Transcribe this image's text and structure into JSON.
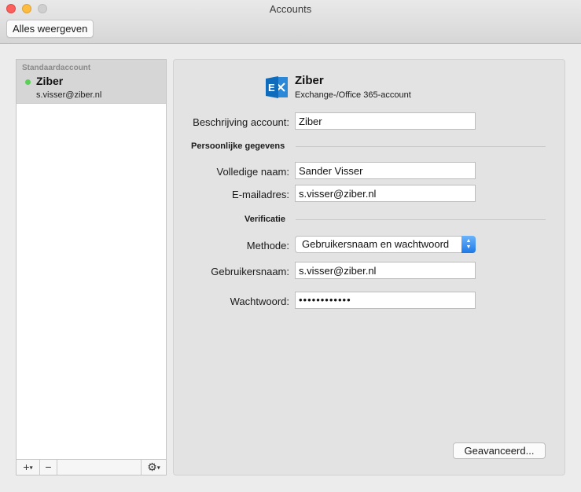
{
  "window": {
    "title": "Accounts",
    "toolbar": {
      "show_all_label": "Alles weergeven"
    }
  },
  "sidebar": {
    "header": "Standaardaccount",
    "accounts": [
      {
        "name": "Ziber",
        "email": "s.visser@ziber.nl",
        "status_color": "#58d155",
        "status": "online"
      }
    ],
    "footer": {
      "add_label": "+",
      "remove_label": "−",
      "gear_icon": "gear-icon"
    }
  },
  "account": {
    "icon": "exchange-icon",
    "name": "Ziber",
    "type": "Exchange-/Office 365-account",
    "description_label": "Beschrijving account:",
    "description_value": "Ziber",
    "personal_section": "Persoonlijke gegevens",
    "full_name_label": "Volledige naam:",
    "full_name_value": "Sander Visser",
    "email_label": "E-mailadres:",
    "email_value": "s.visser@ziber.nl",
    "verification_section": "Verificatie",
    "method_label": "Methode:",
    "method_value": "Gebruikersnaam en wachtwoord",
    "username_label": "Gebruikersnaam:",
    "username_value": "s.visser@ziber.nl",
    "password_label": "Wachtwoord:",
    "password_value": "••••••••••••",
    "advanced_label": "Geavanceerd..."
  },
  "colors": {
    "accent": "#1d79e8",
    "exchange_blue": "#0f6cbd",
    "online": "#58d155"
  }
}
